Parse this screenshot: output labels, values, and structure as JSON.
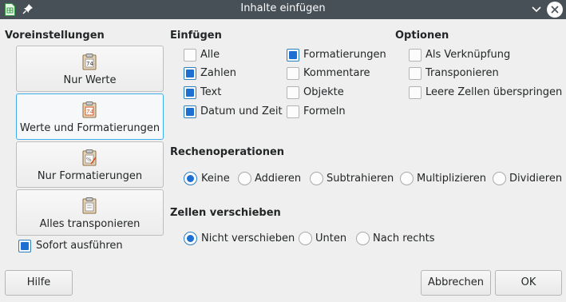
{
  "window": {
    "title": "Inhalte einfügen"
  },
  "icons": {
    "app": "spreadsheet-doc-icon",
    "pin": "pin-icon",
    "minimize": "chevron-down-icon",
    "close": "close-icon",
    "preset_values": "clipboard-values-icon",
    "preset_values_formats": "clipboard-values-formats-icon",
    "preset_formats": "clipboard-formats-icon",
    "preset_transpose": "clipboard-transpose-icon"
  },
  "presets": {
    "title": "Voreinstellungen",
    "items": [
      {
        "label": "Nur Werte"
      },
      {
        "label": "Werte und Formatierungen"
      },
      {
        "label": "Nur Formatierungen"
      },
      {
        "label": "Alles transponieren"
      }
    ],
    "run_immediately": {
      "label": "Sofort ausführen",
      "checked": true
    }
  },
  "insert": {
    "title": "Einfügen",
    "items": [
      {
        "label": "Alle",
        "checked": false
      },
      {
        "label": "Zahlen",
        "checked": true
      },
      {
        "label": "Text",
        "checked": true
      },
      {
        "label": "Datum und Zeit",
        "checked": true
      },
      {
        "label": "Formatierungen",
        "checked": true
      },
      {
        "label": "Kommentare",
        "checked": false
      },
      {
        "label": "Objekte",
        "checked": false
      },
      {
        "label": "Formeln",
        "checked": false
      }
    ]
  },
  "options": {
    "title": "Optionen",
    "items": [
      {
        "label": "Als Verknüpfung",
        "checked": false
      },
      {
        "label": "Transponieren",
        "checked": false
      },
      {
        "label": "Leere Zellen überspringen",
        "checked": false
      }
    ]
  },
  "operations": {
    "title": "Rechenoperationen",
    "selected": "Keine",
    "items": [
      {
        "label": "Keine"
      },
      {
        "label": "Addieren"
      },
      {
        "label": "Subtrahieren"
      },
      {
        "label": "Multiplizieren"
      },
      {
        "label": "Dividieren"
      }
    ]
  },
  "shift": {
    "title": "Zellen verschieben",
    "selected": "Nicht verschieben",
    "items": [
      {
        "label": "Nicht verschieben"
      },
      {
        "label": "Unten"
      },
      {
        "label": "Nach rechts"
      }
    ]
  },
  "buttons": {
    "help": "Hilfe",
    "cancel": "Abbrechen",
    "ok": "OK"
  },
  "colors": {
    "titlebar": "#475057",
    "accent": "#1d6fd1",
    "focus_border": "#3daee9"
  }
}
